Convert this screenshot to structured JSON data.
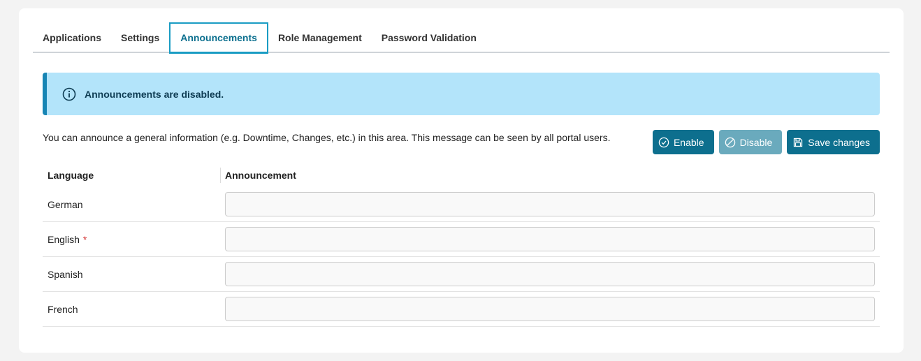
{
  "tabs": [
    {
      "label": "Applications"
    },
    {
      "label": "Settings"
    },
    {
      "label": "Announcements"
    },
    {
      "label": "Role Management"
    },
    {
      "label": "Password Validation"
    }
  ],
  "alert": {
    "text": "Announcements are disabled."
  },
  "description": "You can announce a general information (e.g. Downtime, Changes, etc.) in this area. This message can be seen by all portal users.",
  "buttons": {
    "enable": "Enable",
    "disable": "Disable",
    "save": "Save changes"
  },
  "table": {
    "headers": {
      "language": "Language",
      "announcement": "Announcement"
    },
    "rows": [
      {
        "language": "German",
        "required": "",
        "value": ""
      },
      {
        "language": "English",
        "required": "*",
        "value": ""
      },
      {
        "language": "Spanish",
        "required": "",
        "value": ""
      },
      {
        "language": "French",
        "required": "",
        "value": ""
      }
    ]
  },
  "colors": {
    "accent": "#0d6f8e",
    "alert_bg": "#b3e4fa",
    "alert_border": "#1785b4"
  }
}
